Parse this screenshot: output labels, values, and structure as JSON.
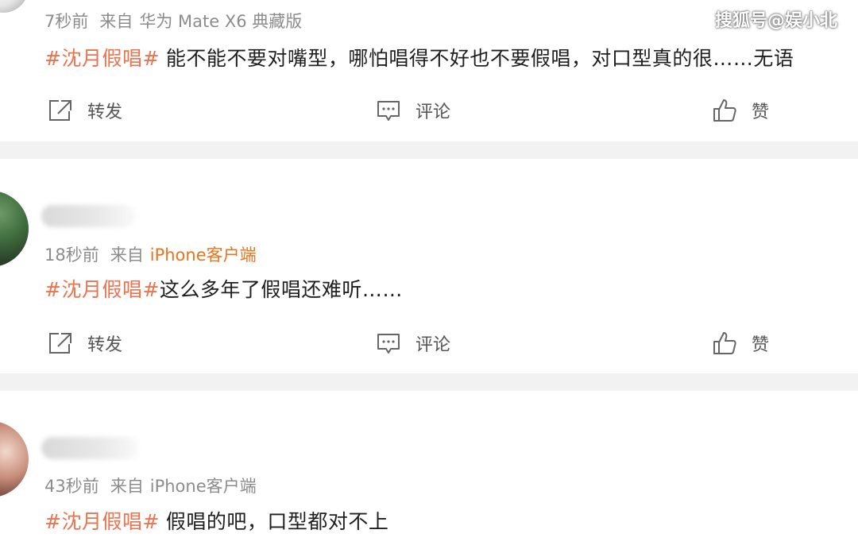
{
  "watermark": "搜狐号@娱小北",
  "posts": [
    {
      "time": "7秒前",
      "source_prefix": "来自",
      "device": "华为 Mate X6 典藏版",
      "topic": "#沈月假唱#",
      "text": "能不能不要对嘴型，哪怕唱得不好也不要假唱，对口型真的很……无语"
    },
    {
      "time": "18秒前",
      "source_prefix": "来自",
      "device": "iPhone客户端",
      "topic": "#沈月假唱#",
      "text": "这么多年了假唱还难听……"
    },
    {
      "time": "43秒前",
      "source_prefix": "来自",
      "device": "iPhone客户端",
      "topic": "#沈月假唱#",
      "text": "假唱的吧，口型都对不上"
    }
  ],
  "actions": {
    "repost": "转发",
    "comment": "评论",
    "like": "赞"
  },
  "icons": {
    "repost": "share-icon",
    "comment": "comment-icon",
    "like": "thumbs-up-icon"
  },
  "colors": {
    "topic": "#eb7350",
    "device_link": "#e9741f",
    "meta": "#8c8c8c",
    "separator": "#f2f2f2"
  }
}
